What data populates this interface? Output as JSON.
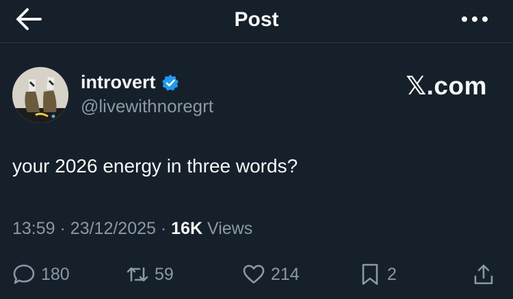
{
  "header": {
    "title": "Post",
    "back_icon": "arrow-left-icon",
    "more_icon": "more-icon"
  },
  "author": {
    "name": "introvert",
    "handle": "@livewithnoregrt",
    "verified": true,
    "verified_color": "#1d9bf0"
  },
  "brand": "𝕏.com",
  "post": {
    "text": "your 2026 energy in three words?",
    "time": "13:59",
    "sep1": "·",
    "date": "23/12/2025",
    "sep2": "·",
    "views_count": "16K",
    "views_label": "Views"
  },
  "actions": {
    "replies": "180",
    "reposts": "59",
    "likes": "214",
    "bookmarks": "2"
  },
  "colors": {
    "background": "#15202b",
    "text": "#f7f9f9",
    "muted": "#8b98a5"
  }
}
